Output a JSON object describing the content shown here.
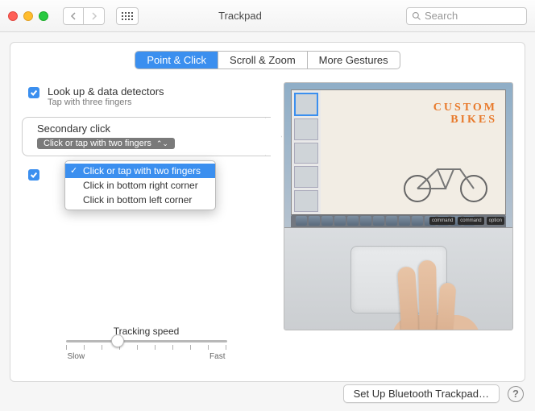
{
  "window": {
    "title": "Trackpad",
    "search_placeholder": "Search"
  },
  "tabs": {
    "point_click": "Point & Click",
    "scroll_zoom": "Scroll & Zoom",
    "more_gestures": "More Gestures"
  },
  "options": {
    "lookup": {
      "label": "Look up & data detectors",
      "sub": "Tap with three fingers"
    },
    "secondary": {
      "label": "Secondary click",
      "selected": "Click or tap with two fingers"
    }
  },
  "dropdown": {
    "items": [
      "Click or tap with two fingers",
      "Click in bottom right corner",
      "Click in bottom left corner"
    ]
  },
  "tracking": {
    "label": "Tracking speed",
    "slow": "Slow",
    "fast": "Fast"
  },
  "preview": {
    "headline1": "CUSTOM",
    "headline2": "BIKES",
    "keys": [
      "command",
      "command",
      "option"
    ]
  },
  "footer": {
    "setup": "Set Up Bluetooth Trackpad…",
    "help": "?"
  }
}
